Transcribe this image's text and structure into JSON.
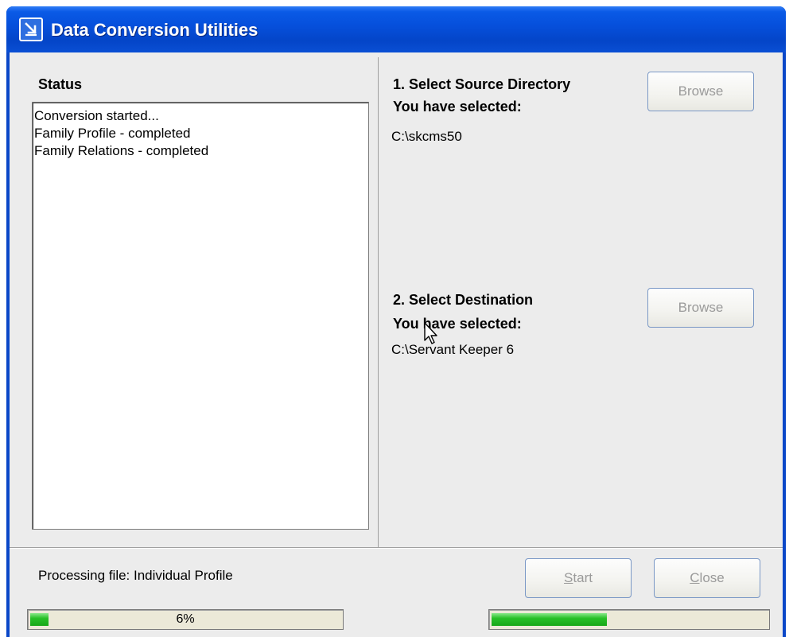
{
  "window": {
    "title": "Data Conversion Utilities",
    "icon": "conversion-arrow-icon"
  },
  "status": {
    "label": "Status",
    "lines": [
      "Conversion started...",
      "Family Profile - completed",
      "Family Relations - completed"
    ]
  },
  "source": {
    "heading": "1.  Select Source Directory",
    "selected_label": "You have selected:",
    "selected_value": "C:\\skcms50",
    "browse_label": "Browse"
  },
  "destination": {
    "heading": "2.  Select Destination",
    "selected_label": "You have selected:",
    "selected_value": "C:\\Servant Keeper 6",
    "browse_label": "Browse"
  },
  "footer": {
    "processing_text": "Processing file: Individual Profile",
    "start_label_underlined": "S",
    "start_label_rest": "tart",
    "close_label_underlined": "C",
    "close_label_rest": "lose"
  },
  "progress": {
    "overall_percent_text": "6%",
    "overall_fraction": 0.06,
    "file_fraction": 0.42
  },
  "colors": {
    "titlebar": "#0650dc",
    "progress_green": "#28c028",
    "panel_bg": "#ececec"
  }
}
